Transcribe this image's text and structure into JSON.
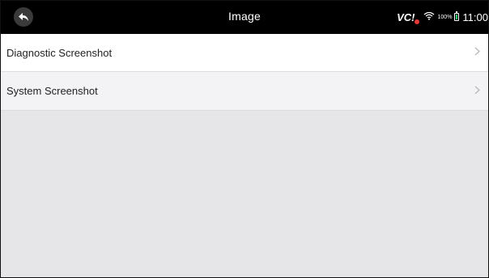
{
  "header": {
    "title": "Image",
    "back_icon": "back-arrow-icon",
    "status": {
      "vci_label": "VC",
      "vci_suffix": "!",
      "battery_percent": "100%",
      "time": "11:00",
      "wifi_icon": "wifi-icon",
      "battery_icon": "battery-icon"
    }
  },
  "list": {
    "items": [
      {
        "label": "Diagnostic Screenshot",
        "icon": "chevron-right-icon"
      },
      {
        "label": "System Screenshot",
        "icon": "chevron-right-icon"
      }
    ]
  },
  "colors": {
    "topbar": "#000000",
    "background": "#e6e5e8",
    "row_primary": "#ffffff",
    "row_secondary": "#f3f3f5",
    "vci_alert": "#e53935",
    "battery_fill": "#2ecc71"
  }
}
